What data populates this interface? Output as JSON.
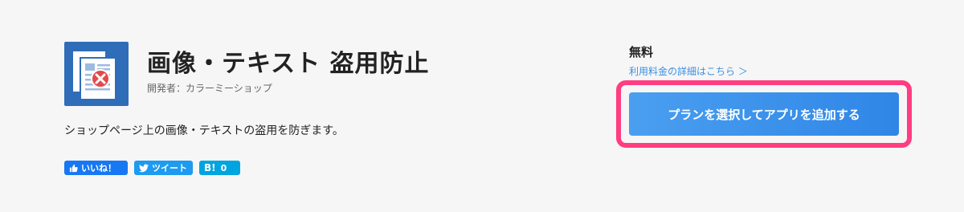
{
  "app": {
    "title": "画像・テキスト 盗用防止",
    "developer": "開発者：カラーミーショップ",
    "description": "ショップページ上の画像・テキストの盗用を防ぎます。",
    "icon": "document-block-icon"
  },
  "social": {
    "like_label": "いいね！",
    "tweet_label": "ツイート",
    "hatena_label": "B!",
    "hatena_count": "0"
  },
  "pricing": {
    "price": "無料",
    "fee_link": "利用料金の詳細はこちら ＞"
  },
  "cta": {
    "add_button": "プランを選択してアプリを追加する"
  },
  "colors": {
    "accent": "#3b8fe0",
    "highlight": "#ff3d80",
    "icon_bg": "#2f6db8",
    "facebook": "#1877f2",
    "twitter": "#1d9bf0",
    "hatena": "#00a4de"
  }
}
